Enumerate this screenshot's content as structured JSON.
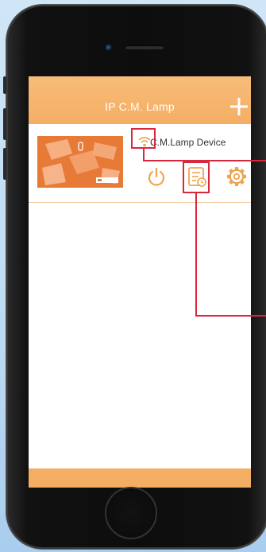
{
  "app": {
    "title": "IP C.M. Lamp",
    "add_icon": "plus-icon"
  },
  "device": {
    "name": "C.M.Lamp Device",
    "status_icon": "wifi-icon",
    "actions": [
      {
        "icon": "power-icon"
      },
      {
        "icon": "schedule-icon"
      },
      {
        "icon": "gear-icon"
      }
    ]
  },
  "colors": {
    "accent": "#f4ae63",
    "icon": "#f0a34f",
    "highlight": "#d8283d",
    "thumbnail": "#e87a38"
  }
}
